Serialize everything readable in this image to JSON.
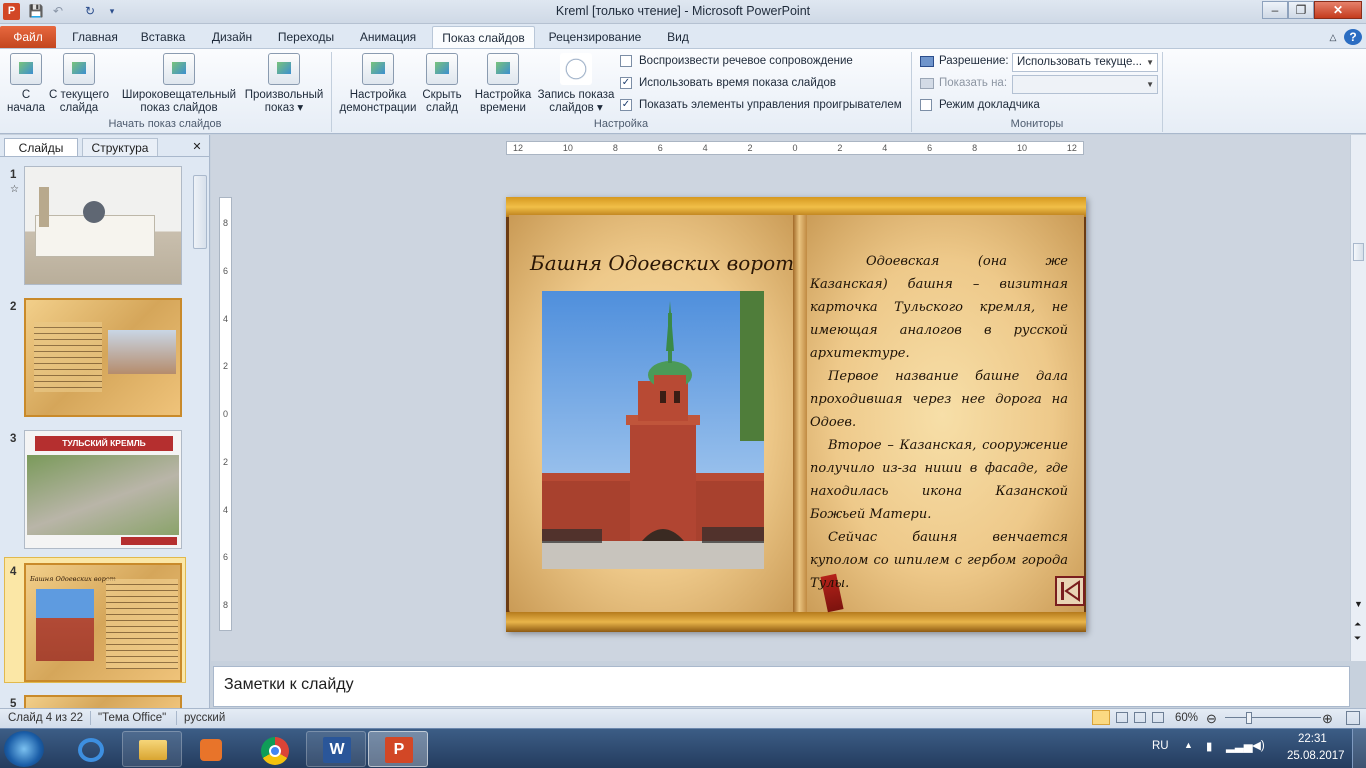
{
  "window": {
    "title": "Kreml [только чтение]  -  Microsoft PowerPoint",
    "app_logo": "P",
    "controls": {
      "minimize": "–",
      "restore": "❐",
      "close": "✕"
    }
  },
  "ribbon_tabs": [
    "Файл",
    "Главная",
    "Вставка",
    "Дизайн",
    "Переходы",
    "Анимация",
    "Показ слайдов",
    "Рецензирование",
    "Вид"
  ],
  "ribbon": {
    "groups": {
      "start": "Начать показ слайдов",
      "setup": "Настройка",
      "monitors": "Мониторы"
    },
    "buttons": {
      "from_start": [
        "С",
        "начала"
      ],
      "from_current": [
        "С текущего",
        "слайда"
      ],
      "broadcast": [
        "Широковещательный",
        "показ слайдов"
      ],
      "custom": [
        "Произвольный",
        "показ ▾"
      ],
      "setup_show": [
        "Настройка",
        "демонстрации"
      ],
      "hide_slide": [
        "Скрыть",
        "слайд"
      ],
      "rehearse": [
        "Настройка",
        "времени"
      ],
      "record": [
        "Запись показа",
        "слайдов ▾"
      ]
    },
    "checks": {
      "narration": {
        "label": "Воспроизвести речевое сопровождение",
        "checked": "☐"
      },
      "timings": {
        "label": "Использовать время показа слайдов",
        "checked": "✓"
      },
      "controls": {
        "label": "Показать элементы управления проигрывателем",
        "checked": "✓"
      },
      "presenter": {
        "label": "Режим докладчика",
        "checked": "☐"
      }
    },
    "resolution_label": "Разрешение:",
    "resolution_value": "Использовать текуще...",
    "show_on_label": "Показать на:",
    "show_on_value": ""
  },
  "left_pane": {
    "tab_slides": "Слайды",
    "tab_outline": "Структура",
    "close": "✕",
    "slides": [
      {
        "num": "1",
        "star": "☆"
      },
      {
        "num": "2"
      },
      {
        "num": "3",
        "banner": "ТУЛЬСКИЙ КРЕМЛЬ"
      },
      {
        "num": "4",
        "title": "Башня Одоевских ворот"
      },
      {
        "num": "5"
      }
    ]
  },
  "ruler": {
    "h": [
      "12",
      "10",
      "8",
      "6",
      "4",
      "2",
      "0",
      "2",
      "4",
      "6",
      "8",
      "10",
      "12"
    ],
    "v": [
      "8",
      "6",
      "4",
      "2",
      "0",
      "2",
      "4",
      "6",
      "8"
    ]
  },
  "slide": {
    "title": "Башня Одоевских ворот",
    "paragraphs": [
      "Одоевская (она же Казанская) башня – визитная карточка Тульского кремля, не имеющая аналогов в русской архитектуре.",
      "Первое название башне дала проходившая через нее дорога на Одоев.",
      "Второе – Казанская, сооружение получило из-за ниши в фасаде, где находилась икона Казанской Божьей Матери.",
      "Сейчас башня венчается куполом со шпилем с гербом города Тулы."
    ]
  },
  "notes_placeholder": "Заметки к слайду",
  "status": {
    "slide_pos": "Слайд 4 из 22",
    "theme": "\"Тема Office\"",
    "lang": "русский",
    "zoom": "60%"
  },
  "taskbar": {
    "lang": "RU",
    "time": "22:31",
    "date": "25.08.2017"
  }
}
